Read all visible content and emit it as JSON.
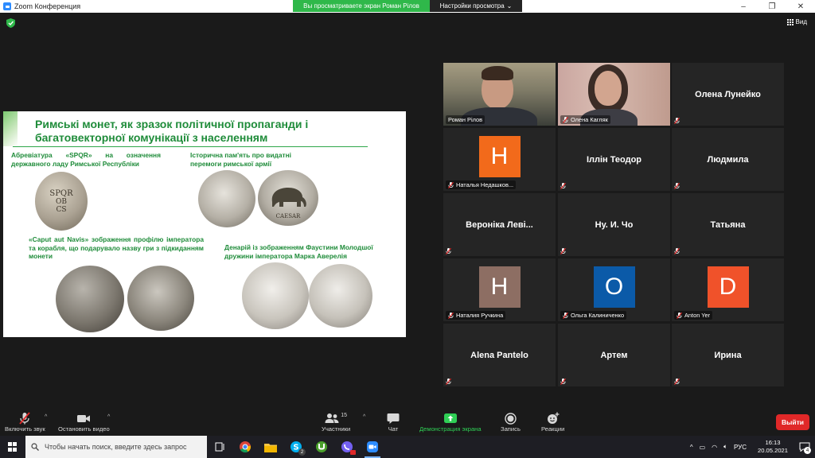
{
  "window": {
    "title": "Zoom Конференция",
    "share_banner": "Вы просматриваете экран Роман Рілов",
    "view_settings": "Настройки просмотра",
    "view_button": "Вид",
    "controls": [
      "–",
      "❐",
      "✕"
    ]
  },
  "slide": {
    "title": "Римські монет, як зразок політичної пропаганди і багатовекторної комунікації з населенням",
    "captions": [
      "Абревіатура «SPQR» на означення державного ладу Римської Республіки",
      "Історична пам'ять про видатні перемоги римської армії",
      "«Caput aut Navis» зображення профілю імператора та корабля, що подарувало назву гри з підкиданням монети",
      "Денарій із зображенням Фаустини Молодшої дружини імператора  Марка Аверелія"
    ],
    "coin_texts": {
      "spqr": [
        "SPQR",
        "OB",
        "CS"
      ],
      "caesar": "CAESAR"
    }
  },
  "participants": [
    {
      "name": "Роман Рілов",
      "type": "video",
      "active": true
    },
    {
      "name": "Олена Кагляк",
      "type": "video"
    },
    {
      "name": "Олена Лунейко",
      "type": "name"
    },
    {
      "name": "Наталья Недашков...",
      "type": "avatar",
      "initial": "H",
      "color": "#f26a1b"
    },
    {
      "name": "Іллін Теодор",
      "type": "name"
    },
    {
      "name": "Людмила",
      "type": "name"
    },
    {
      "name": "Вероніка Леві...",
      "type": "name"
    },
    {
      "name": "Ну. И. Чо",
      "type": "name"
    },
    {
      "name": "Татьяна",
      "type": "name"
    },
    {
      "name": "Наталия Ручкина",
      "type": "avatar",
      "initial": "H",
      "color": "#8d6e63"
    },
    {
      "name": "Ольга Калиниченко",
      "type": "avatar",
      "initial": "O",
      "color": "#0b5aa8"
    },
    {
      "name": "Anton Yer",
      "type": "avatar",
      "initial": "D",
      "color": "#f0522a"
    },
    {
      "name": "Alena Pantelo",
      "type": "name"
    },
    {
      "name": "Артем",
      "type": "name"
    },
    {
      "name": "Ирина",
      "type": "name"
    }
  ],
  "toolbar": {
    "mute_label": "Включить звук",
    "video_label": "Остановить видео",
    "participants_label": "Участники",
    "participants_count": "15",
    "chat_label": "Чат",
    "share_label": "Демонстрация экрана",
    "record_label": "Запись",
    "reactions_label": "Реакции",
    "leave_label": "Выйти"
  },
  "taskbar": {
    "search_placeholder": "Чтобы начать поиск, введите здесь запрос",
    "skype_badge": "2",
    "language": "РУС",
    "time": "16:13",
    "date": "20.05.2021",
    "notification_count": "4"
  },
  "colors": {
    "share_green": "#2fb84a",
    "active_outline": "#c6d52c",
    "leave_red": "#e02828",
    "slide_green": "#1f8c3a"
  }
}
